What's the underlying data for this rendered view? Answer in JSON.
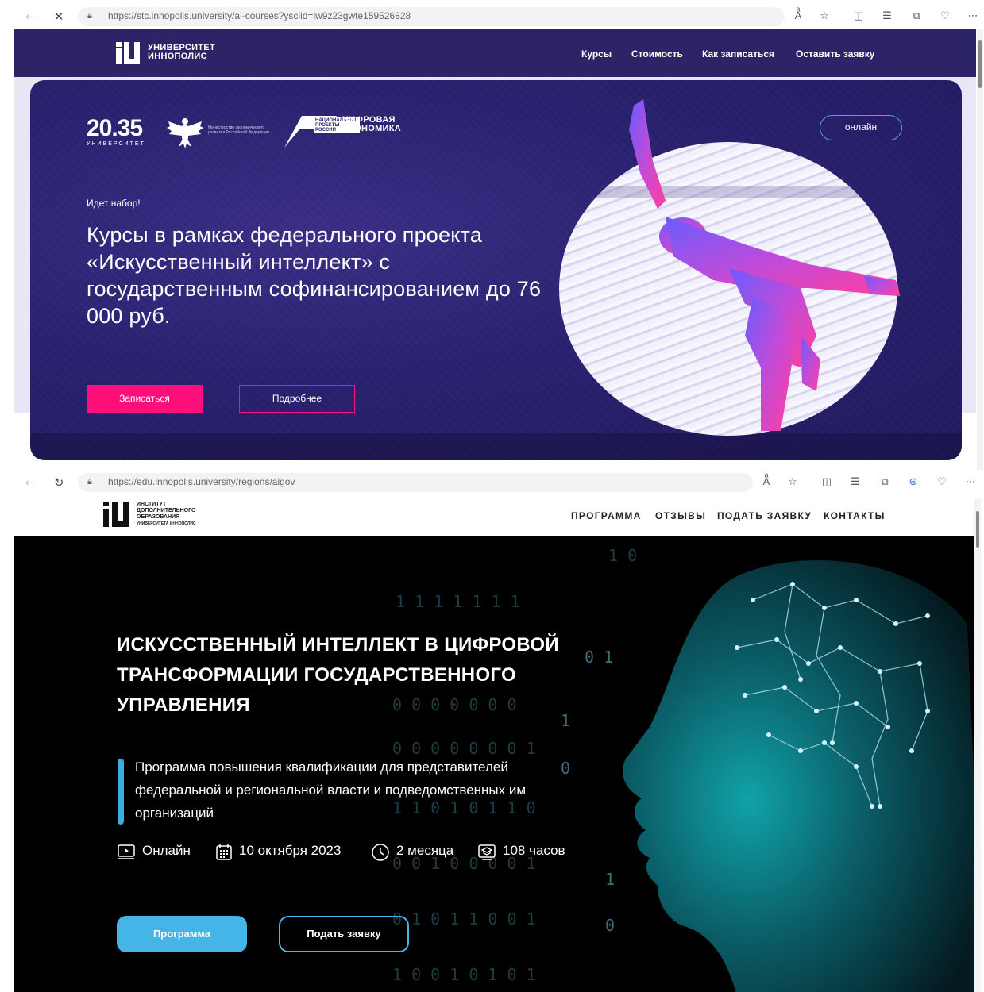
{
  "browser_top": {
    "url": "https://stc.innopolis.university/ai-courses?ysclid=lw9z23gwte159526828",
    "back_icon": "arrow-left-icon",
    "stop_icon": "close-icon"
  },
  "page1": {
    "logo_line1": "УНИВЕРСИТЕТ",
    "logo_line2": "ИННОПОЛИС",
    "nav": [
      "Курсы",
      "Стоимость",
      "Как записаться",
      "Оставить заявку"
    ],
    "partner_2035": "20.35",
    "partner_2035_sub": "УНИВЕРСИТЕТ",
    "ministry_text": "Министерство экономического развития Российской Федерации",
    "digecon_badge_1": "НАЦИОНАЛЬНЫЕ",
    "digecon_badge_2": "ПРОЕКТЫ",
    "digecon_badge_3": "РОССИИ",
    "digecon_line1": "ЦИФРОВАЯ",
    "digecon_line2": "ЭКОНОМИКА",
    "online_label": "онлайн",
    "recruit_label": "Идет набор!",
    "title": "Курсы в рамках федерального проекта «Искусственный интеллект» с государственным софинансированием до 76 000 руб.",
    "btn_enroll": "Записаться",
    "btn_more": "Подробнее",
    "colors": {
      "primary": "#2c2466",
      "accent": "#ff0f7b",
      "pill_border": "#4ea3e0"
    }
  },
  "browser_bottom": {
    "url": "https://edu.innopolis.university/regions/aigov"
  },
  "page2": {
    "logo_line1": "ИНСТИТУТ",
    "logo_line2": "ДОПОЛНИТЕЛЬНОГО",
    "logo_line3": "ОБРАЗОВАНИЯ",
    "logo_line4": "УНИВЕРСИТЕТА ИННОПОЛИС",
    "nav": [
      "ПРОГРАММА",
      "ОТЗЫВЫ",
      "ПОДАТЬ ЗАЯВКУ",
      "КОНТАКТЫ"
    ],
    "title": "ИСКУССТВЕННЫЙ ИНТЕЛЛЕКТ В ЦИФРОВОЙ ТРАНСФОРМАЦИИ ГОСУДАРСТВЕННОГО УПРАВЛЕНИЯ",
    "description": "Программа повышения квалификации для представителей федеральной и региональной власти и подведомственных им организаций",
    "meta": {
      "format": "Онлайн",
      "start_date": "10 октября 2023",
      "duration": "2 месяца",
      "hours": "108 часов"
    },
    "btn_program": "Программа",
    "btn_apply": "Подать заявку",
    "colors": {
      "accent": "#45b4e6",
      "background": "#000000",
      "head": "#0d7f86"
    }
  }
}
